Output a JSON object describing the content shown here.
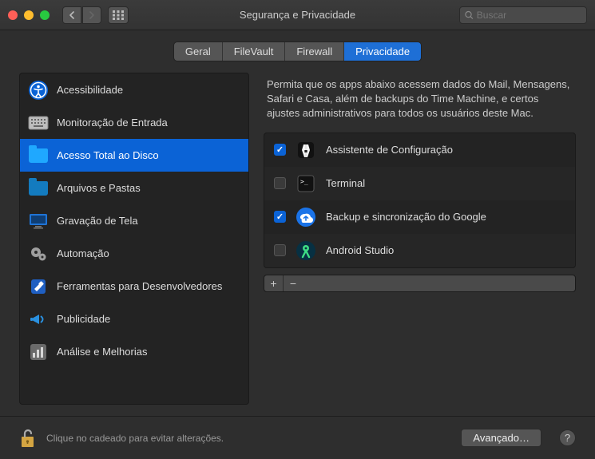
{
  "window": {
    "title": "Segurança e Privacidade"
  },
  "search": {
    "placeholder": "Buscar"
  },
  "tabs": [
    {
      "label": "Geral",
      "active": false
    },
    {
      "label": "FileVault",
      "active": false
    },
    {
      "label": "Firewall",
      "active": false
    },
    {
      "label": "Privacidade",
      "active": true
    }
  ],
  "sidebar": {
    "items": [
      {
        "label": "Acessibilidade",
        "icon": "accessibility-icon",
        "selected": false
      },
      {
        "label": "Monitoração de Entrada",
        "icon": "keyboard-icon",
        "selected": false
      },
      {
        "label": "Acesso Total ao Disco",
        "icon": "folder-icon",
        "selected": true
      },
      {
        "label": "Arquivos e Pastas",
        "icon": "folder-icon",
        "selected": false
      },
      {
        "label": "Gravação de Tela",
        "icon": "display-icon",
        "selected": false
      },
      {
        "label": "Automação",
        "icon": "gears-icon",
        "selected": false
      },
      {
        "label": "Ferramentas para Desenvolvedores",
        "icon": "hammer-icon",
        "selected": false
      },
      {
        "label": "Publicidade",
        "icon": "megaphone-icon",
        "selected": false
      },
      {
        "label": "Análise e Melhorias",
        "icon": "chart-icon",
        "selected": false
      }
    ]
  },
  "detail": {
    "description": "Permita que os apps abaixo acessem dados do Mail, Mensagens, Safari e Casa, além de backups do Time Machine, e certos ajustes administrativos para todos os usuários deste Mac.",
    "apps": [
      {
        "name": "Assistente de Configuração",
        "checked": true,
        "icon": "setup-assistant-icon"
      },
      {
        "name": "Terminal",
        "checked": false,
        "icon": "terminal-icon"
      },
      {
        "name": "Backup e sincronização do Google",
        "checked": true,
        "icon": "google-backup-icon"
      },
      {
        "name": "Android Studio",
        "checked": false,
        "icon": "android-studio-icon"
      }
    ]
  },
  "footer": {
    "lock_text": "Clique no cadeado para evitar alterações.",
    "advanced": "Avançado…"
  }
}
